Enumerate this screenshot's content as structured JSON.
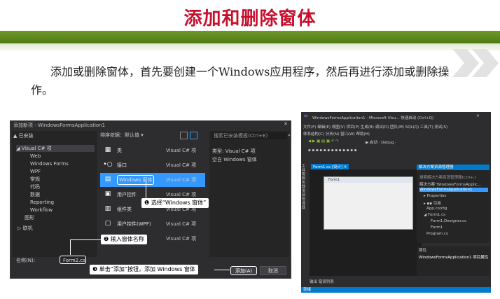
{
  "slide": {
    "title": "添加和删除窗体",
    "paragraph": "添加或删除窗体，首先要创建一个Windows应用程序，然后再进行添加或删除操作。"
  },
  "dialog": {
    "window_title": "添加新项 - WindowsFormsApplication1",
    "close": "✕",
    "installed": "▲ 已安装",
    "tree": [
      "◢ Visual C# 项",
      "Web",
      "Windows Forms",
      "WPF",
      "常规",
      "代码",
      "数据",
      "Reporting",
      "Workflow",
      "图形",
      "▷ 联机"
    ],
    "sort_label": "排序依据：",
    "sort_value": "默认值",
    "search_placeholder": "搜索已安装模板(Ctrl+E)",
    "templates": [
      {
        "icon": "▦",
        "name": "类",
        "type": "Visual C# 项"
      },
      {
        "icon": "•○",
        "name": "接口",
        "type": "Visual C# 项"
      },
      {
        "icon": "▤",
        "name": "Windows 窗体",
        "type": "Visual C# 项"
      },
      {
        "icon": "▣",
        "name": "用户控件",
        "type": "Visual C# 项"
      },
      {
        "icon": "▥",
        "name": "组件类",
        "type": "Visual C# 项"
      },
      {
        "icon": "▢",
        "name": "用户控件(WPF)",
        "type": "Visual C# 项"
      },
      {
        "icon": "▧",
        "name": "关于框",
        "type": "Visual C# 项"
      }
    ],
    "detail_type": "类型:  Visual C# 项",
    "detail_desc": "空白 Windows 窗体",
    "name_label": "名称(N):",
    "name_value": "Form2.cs",
    "add_button": "添加(A)",
    "cancel_button": "取消"
  },
  "callouts": {
    "step1": "❶ 选择“Windows 窗体”",
    "step2": "❷ 输入窗体名称",
    "step3": "❸ 单击“添加”按钮，添加 Windows 窗体"
  },
  "vs": {
    "title": "WindowsFormsApplication1 - Microsoft Visu... 快速启动 (Ctrl+Q)",
    "menu": "文件(F)  编辑(E)  视图(V)  项目(P)  生成(B)  调试(D)  团队(M)  SQL(Q)  工具(T)  测试(S)",
    "menu2": "体系结构(C)  分析(N)  窗口(W)  帮助(H)",
    "debug": "▶ 启动 · Debug ·",
    "tab": "Form1.cs [设计]  ✕",
    "form_title": "Form1",
    "solution_title": "解决方案资源管理器",
    "solution_search": "搜索解决方案资源管理器(Ctrl+;)",
    "solution_items": [
      "解决方案“WindowsFormsApplic...",
      "WindowsFormsApplication1",
      "▸ Properties",
      "▸ ▪▪ 引用",
      "App.config",
      "◢ Form1.cs",
      "Form1.Designer.cs",
      "Form1",
      "Program.cs"
    ],
    "properties_title": "属性",
    "properties_obj": "WindowsFormsApplication1 项目属性",
    "bottom_tabs": "输出  错误列表",
    "status": "就绪",
    "side_tabs": "工具箱  服务器资源管理器"
  }
}
